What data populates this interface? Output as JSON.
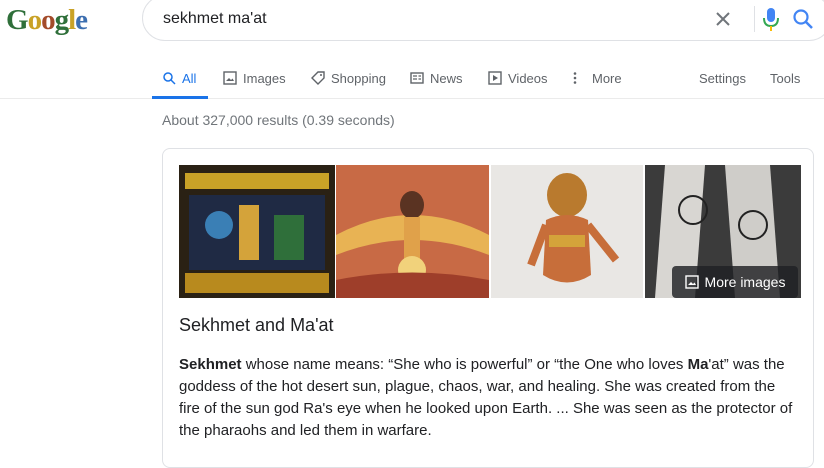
{
  "logo": {
    "letters": [
      "G",
      "o",
      "o",
      "g",
      "l",
      "e"
    ],
    "colors": [
      "#2f6f3a",
      "#c9a227",
      "#a34b2a",
      "#2f6f3a",
      "#c9a227",
      "#3d6fb0"
    ]
  },
  "search": {
    "query": "sekhmet ma'at"
  },
  "tabs": [
    {
      "label": "All",
      "icon": "search-icon"
    },
    {
      "label": "Images",
      "icon": "image-icon"
    },
    {
      "label": "Shopping",
      "icon": "tag-icon"
    },
    {
      "label": "News",
      "icon": "news-icon"
    },
    {
      "label": "Videos",
      "icon": "play-icon"
    },
    {
      "label": "More",
      "icon": "more-vert-icon"
    }
  ],
  "tools": {
    "settings": "Settings",
    "tools": "Tools"
  },
  "stats": "About 327,000 results (0.39 seconds)",
  "knowledge_panel": {
    "more_images": "More images",
    "title": "Sekhmet and Ma'at",
    "desc_bold1": "Sekhmet",
    "desc_part1": " whose name means: “She who is powerful” or “the One who loves ",
    "desc_bold2": "Ma",
    "desc_part2": "'at” was the goddess of the hot desert sun, plague, chaos, war, and healing. She was created from the fire of the sun god Ra's eye when he looked upon Earth. ... She was seen as the protector of the pharaohs and led them in warfare."
  }
}
